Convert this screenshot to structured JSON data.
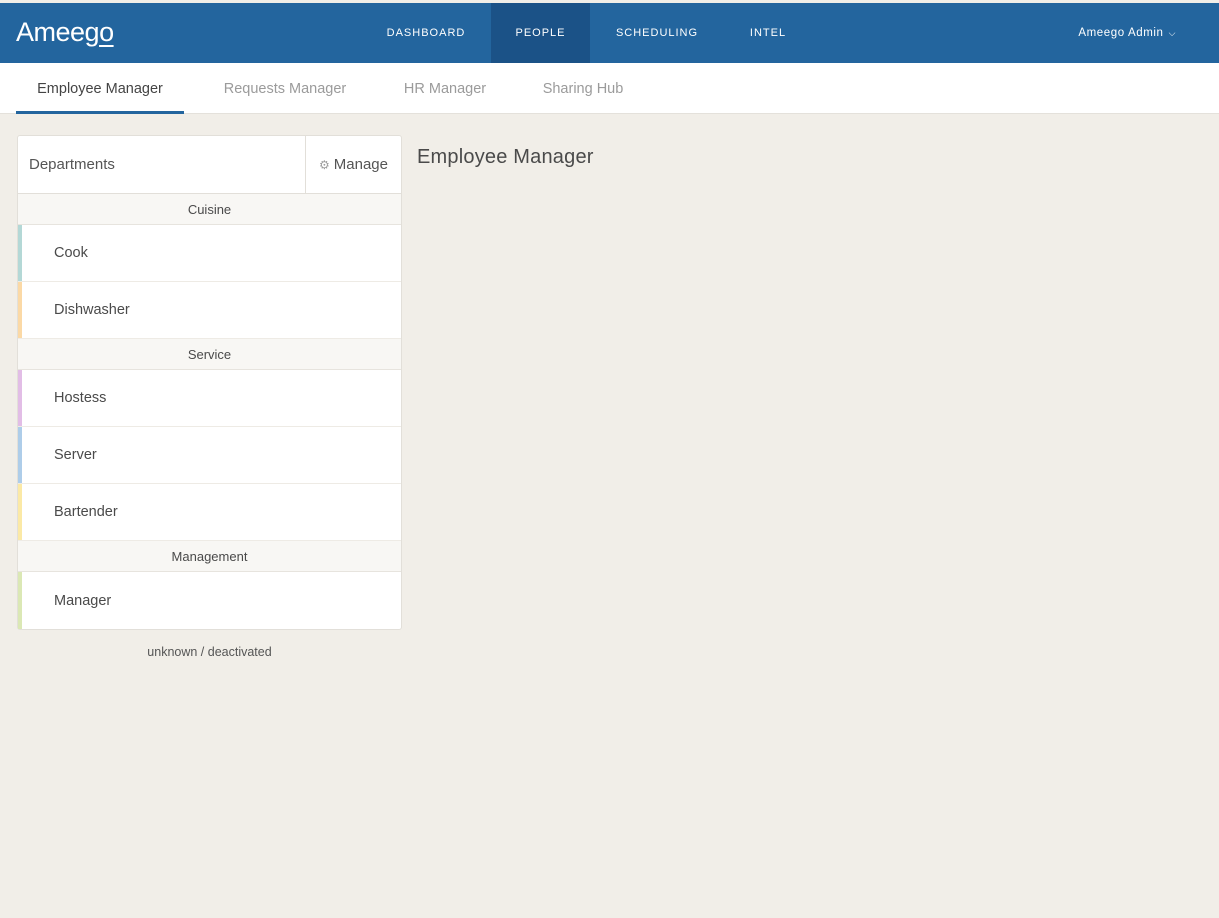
{
  "app": {
    "logo_text": "Ameeg",
    "logo_tail": "o"
  },
  "nav": {
    "items": [
      {
        "label": "DASHBOARD"
      },
      {
        "label": "PEOPLE",
        "active": true
      },
      {
        "label": "SCHEDULING"
      },
      {
        "label": "INTEL"
      }
    ],
    "user": {
      "label": "Ameego Admin",
      "icon": "chevron-down-icon"
    }
  },
  "subnav": {
    "tabs": [
      {
        "label": "Employee Manager",
        "active": true
      },
      {
        "label": "Requests Manager"
      },
      {
        "label": "HR Manager"
      },
      {
        "label": "Sharing Hub"
      }
    ]
  },
  "departments": {
    "title": "Departments",
    "manage_label": "Manage",
    "manage_icon": "gear-icon",
    "groups": [
      {
        "name": "Cuisine",
        "roles": [
          {
            "label": "Cook",
            "color": "#b4d8d6"
          },
          {
            "label": "Dishwasher",
            "color": "#fbd9a6"
          }
        ]
      },
      {
        "name": "Service",
        "roles": [
          {
            "label": "Hostess",
            "color": "#e2bde6"
          },
          {
            "label": "Server",
            "color": "#aecde9"
          },
          {
            "label": "Bartender",
            "color": "#fbe9a6"
          }
        ]
      },
      {
        "name": "Management",
        "roles": [
          {
            "label": "Manager",
            "color": "#dbe8b5"
          }
        ]
      }
    ],
    "footer": "unknown / deactivated"
  },
  "main": {
    "title": "Employee Manager"
  },
  "colors": {
    "topbar": "#23659e",
    "topbar_active": "#1b5287",
    "background": "#f1eee8"
  }
}
